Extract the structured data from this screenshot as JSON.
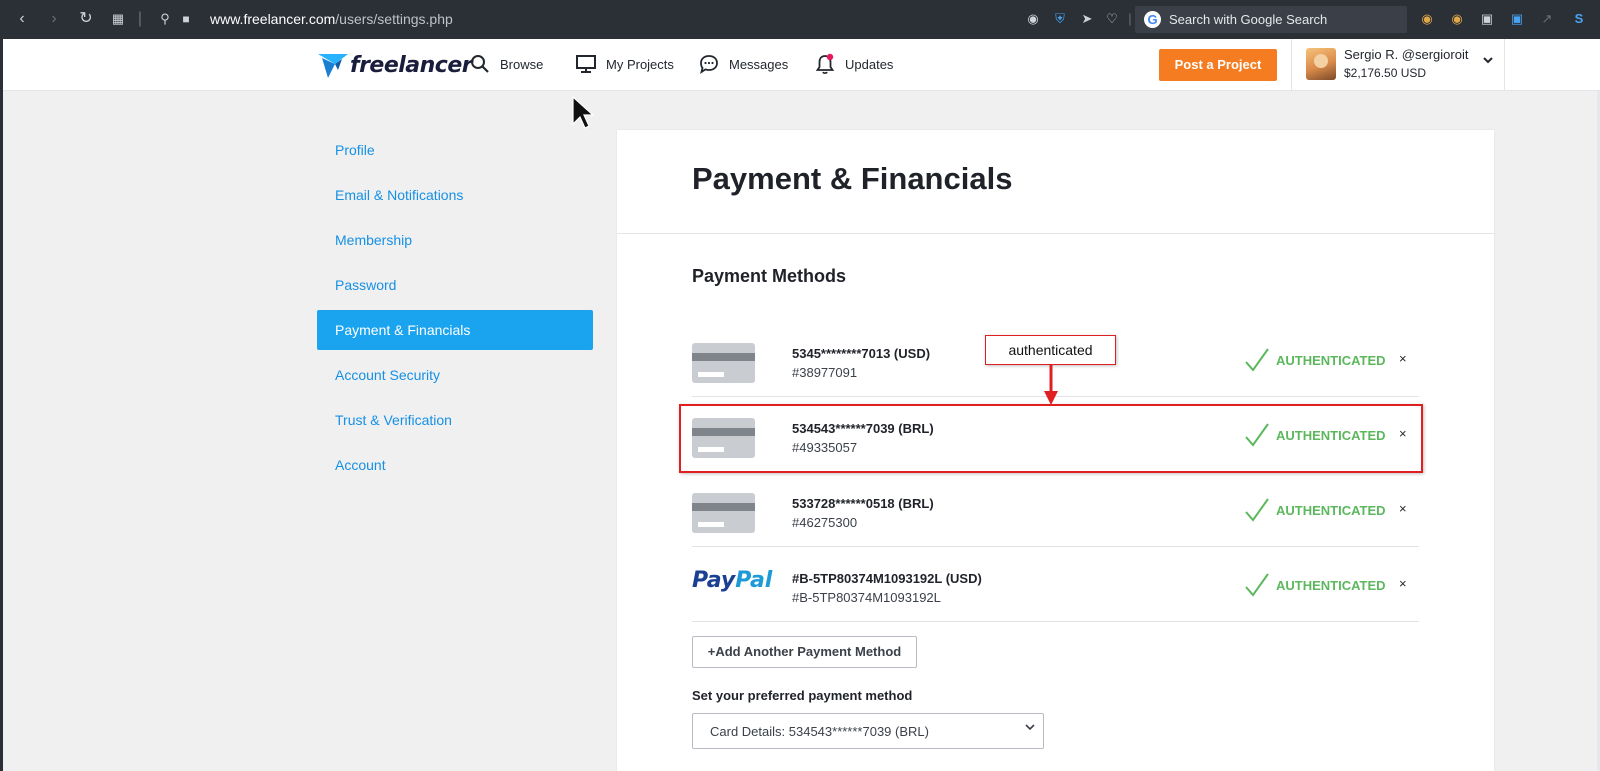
{
  "browser": {
    "url_domain": "www.freelancer.com",
    "url_path": "/users/settings.php",
    "search_placeholder": "Search with Google Search"
  },
  "topnav": {
    "logo_text": "freelancer",
    "browse": "Browse",
    "my_projects": "My Projects",
    "messages": "Messages",
    "updates": "Updates",
    "post_project": "Post a Project",
    "user_name": "Sergio R. @sergioroit",
    "user_balance": "$2,176.50 USD"
  },
  "sidebar": {
    "items": [
      {
        "label": "Profile"
      },
      {
        "label": "Email & Notifications"
      },
      {
        "label": "Membership"
      },
      {
        "label": "Password"
      },
      {
        "label": "Payment & Financials"
      },
      {
        "label": "Account Security"
      },
      {
        "label": "Trust & Verification"
      },
      {
        "label": "Account"
      }
    ],
    "active_index": 4
  },
  "main": {
    "title": "Payment & Financials",
    "section_title": "Payment Methods",
    "methods": [
      {
        "type": "card",
        "number": "5345********7013 (USD)",
        "id": "#38977091",
        "status": "AUTHENTICATED",
        "remove": "×"
      },
      {
        "type": "card",
        "number": "534543******7039 (BRL)",
        "id": "#49335057",
        "status": "AUTHENTICATED",
        "remove": "×"
      },
      {
        "type": "card",
        "number": "533728******0518 (BRL)",
        "id": "#46275300",
        "status": "AUTHENTICATED",
        "remove": "×"
      },
      {
        "type": "paypal",
        "brand_pay": "Pay",
        "brand_pal": "Pal",
        "number": "#B-5TP80374M1093192L (USD)",
        "id": "#B-5TP80374M1093192L",
        "status": "AUTHENTICATED",
        "remove": "×"
      }
    ],
    "add_button": "+Add Another Payment Method",
    "preferred_label": "Set your preferred payment method",
    "preferred_value": "Card Details: 534543******7039 (BRL)"
  },
  "annotation": {
    "label": "authenticated"
  },
  "colors": {
    "accent_blue": "#1aa3ef",
    "link_blue": "#1590e5",
    "post_orange": "#f57c20",
    "auth_green": "#5cb85c",
    "annotation_red": "#e02020"
  }
}
